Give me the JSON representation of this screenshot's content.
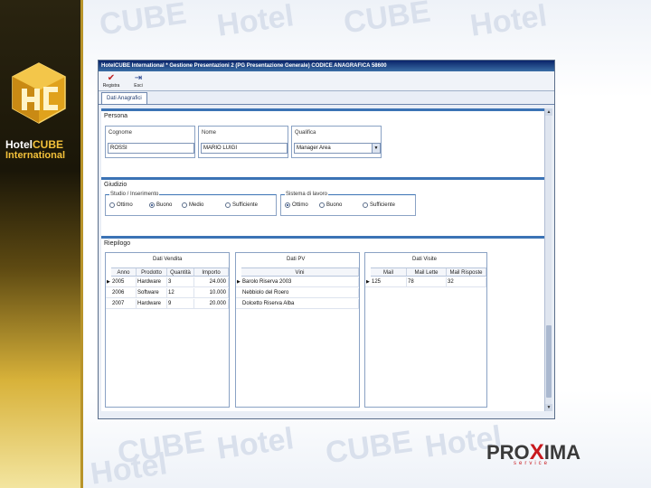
{
  "watermark": {
    "text_a": "Hotel",
    "text_b": "CUBE"
  },
  "brand": {
    "logo_text_1": "Hotel",
    "logo_text_1b": "CUBE",
    "logo_text_2": "International",
    "accent": "#f3c13a"
  },
  "window": {
    "title": "HotelCUBE International   * Gestione Presentazioni 2 (PG   Presentazione Generale)   CODICE ANAGRAFICA 58600"
  },
  "toolbar": {
    "save_label": "Registra",
    "exit_label": "Esci"
  },
  "tabs": [
    {
      "label": "Dati Anagrafici"
    }
  ],
  "persona": {
    "title": "Persona",
    "cognome_label": "Cognome",
    "cognome_value": "ROSSI",
    "nome_label": "Nome",
    "nome_value": "MARIO LUIGI",
    "qualifica_label": "Qualifica",
    "qualifica_value": "Manager Area"
  },
  "giudizio": {
    "title": "Giudizio",
    "studio_label": "Studio / Inserimento",
    "studio_options": [
      "Ottimo",
      "Buono",
      "Medio",
      "Sufficiente"
    ],
    "studio_selected": 1,
    "sistema_label": "Sistema di lavoro",
    "sistema_options": [
      "Ottimo",
      "Buono",
      "Sufficiente"
    ],
    "sistema_selected": 0
  },
  "riepilogo": {
    "title": "Riepilogo",
    "grid1": {
      "title": "Dati Vendita",
      "headers": [
        "Anno",
        "Prodotto",
        "Quantità",
        "Importo"
      ],
      "rows": [
        [
          "2005",
          "Hardware",
          "3",
          "24.000"
        ],
        [
          "2006",
          "Software",
          "12",
          "10.000"
        ],
        [
          "2007",
          "Hardware",
          "9",
          "20.000"
        ]
      ]
    },
    "grid2": {
      "title": "Dati PV",
      "headers": [
        "Vini"
      ],
      "rows": [
        [
          "Barolo Riserva 2003"
        ],
        [
          "Nebbiolo del Roero"
        ],
        [
          "Dolcetto Riserva Alba"
        ]
      ]
    },
    "grid3": {
      "title": "Dati Visite",
      "headers": [
        "Mail",
        "Mail Lette",
        "Mail Risposte"
      ],
      "rows": [
        [
          "125",
          "78",
          "32"
        ]
      ]
    }
  },
  "proxima": {
    "word_a": "PRO",
    "word_x": "X",
    "word_b": "IMA",
    "sub": "service"
  }
}
